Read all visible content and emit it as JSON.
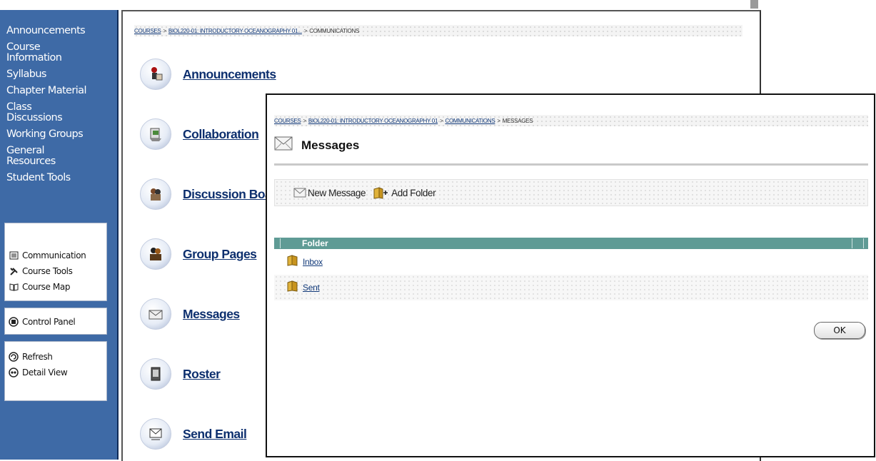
{
  "sidebar": {
    "nav_items": [
      {
        "label": "Announcements"
      },
      {
        "label": "Course\nInformation"
      },
      {
        "label": "Syllabus"
      },
      {
        "label": "Chapter Material"
      },
      {
        "label": "Class\nDiscussions"
      },
      {
        "label": "Working Groups"
      },
      {
        "label": "General\nResources"
      },
      {
        "label": "Student Tools"
      }
    ],
    "tools": {
      "communication": "Communication",
      "course_tools": "Course Tools",
      "course_map": "Course Map",
      "control_panel": "Control Panel",
      "refresh": "Refresh",
      "detail_view": "Detail View"
    }
  },
  "main": {
    "breadcrumb": {
      "courses": "COURSES",
      "sep1": ">",
      "course": "BIOL220-01: INTRODUCTORY OCEANOGRAPHY 01...",
      "sep2": ">",
      "current": "COMMUNICATIONS"
    },
    "items": {
      "announcements": "Announcements",
      "collaboration": "Collaboration",
      "discussion_board": "Discussion Board",
      "group_pages": "Group Pages",
      "messages": "Messages",
      "roster": "Roster",
      "send_email": "Send Email"
    }
  },
  "dialog": {
    "breadcrumb": {
      "courses": "COURSES",
      "sep1": ">",
      "course": "BIOL220-01: INTRODUCTORY OCEANOGRAPHY 01",
      "sep2": ">",
      "communications": "COMMUNICATIONS",
      "sep3": ">",
      "current": "MESSAGES"
    },
    "title": "Messages",
    "actions": {
      "new_message": "New Message",
      "add_folder": "Add Folder"
    },
    "table_header": "Folder",
    "folders": [
      "Inbox",
      "Sent"
    ],
    "ok_label": "OK"
  },
  "colors": {
    "sidebar_bg": "#3e6aa6",
    "table_header": "#5f9b95",
    "link": "#0d2f6e"
  }
}
